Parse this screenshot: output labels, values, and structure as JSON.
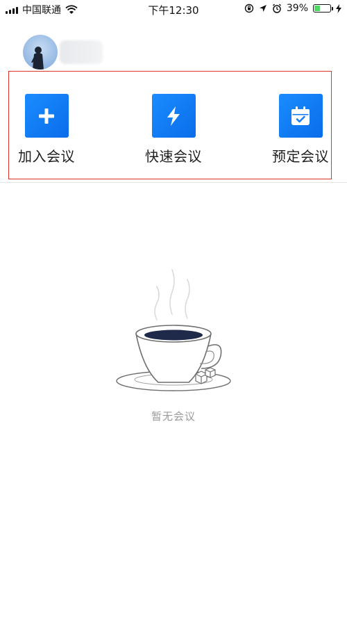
{
  "status_bar": {
    "carrier": "中国联通",
    "time": "下午12:30",
    "battery": "39%",
    "battery_level": 0.39,
    "icons": [
      "signal-icon",
      "wifi-icon",
      "orientation-lock-icon",
      "location-icon",
      "alarm-icon",
      "battery-icon",
      "charging-icon"
    ]
  },
  "profile": {
    "avatar_icon": "avatar-photo"
  },
  "actions": [
    {
      "label": "加入会议",
      "icon": "plus-icon"
    },
    {
      "label": "快速会议",
      "icon": "lightning-icon"
    },
    {
      "label": "预定会议",
      "icon": "calendar-check-icon"
    }
  ],
  "empty_state": {
    "text": "暂无会议",
    "icon": "coffee-cup-illustration"
  },
  "colors": {
    "accent": "#1a8cff",
    "highlight_border": "#e0302a",
    "battery_green": "#4cd964"
  }
}
